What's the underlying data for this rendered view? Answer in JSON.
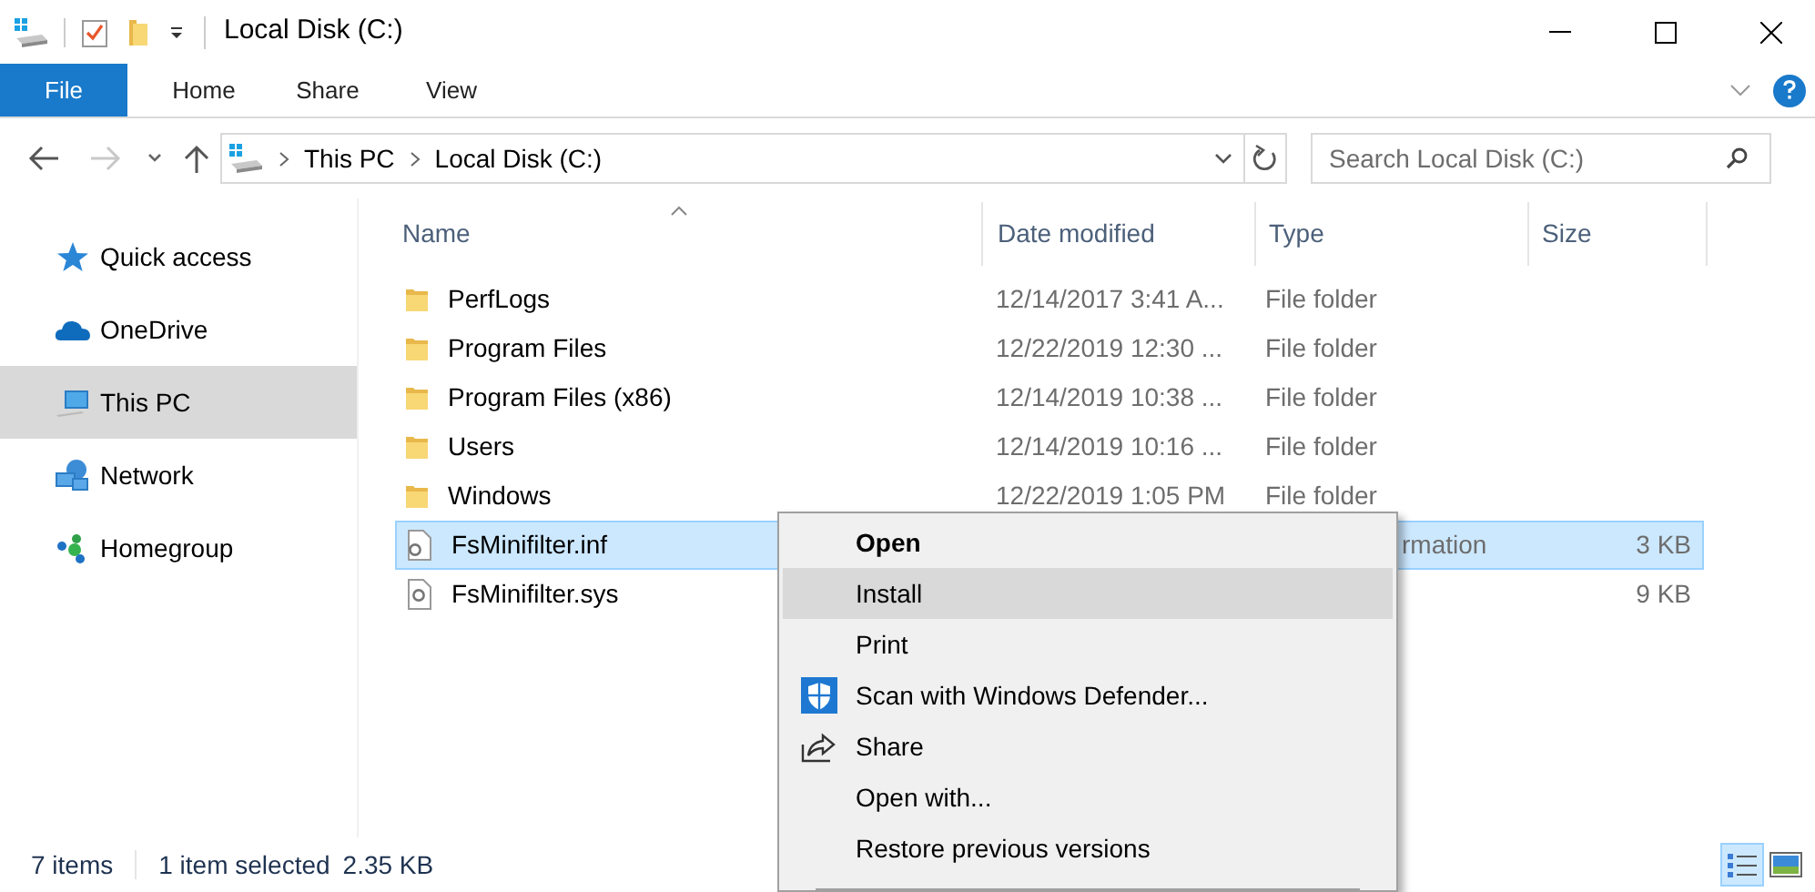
{
  "window": {
    "title": "Local Disk (C:)"
  },
  "ribbon_tabs": [
    {
      "label": "File",
      "kind": "file",
      "selected": false
    },
    {
      "label": "Home",
      "kind": "tab",
      "selected": false
    },
    {
      "label": "Share",
      "kind": "tab",
      "selected": false
    },
    {
      "label": "View",
      "kind": "tab",
      "selected": false
    }
  ],
  "address_bar": {
    "path": [
      "This PC",
      "Local Disk (C:)"
    ]
  },
  "search": {
    "placeholder": "Search Local Disk (C:)"
  },
  "sidebar": {
    "items": [
      {
        "label": "Quick access",
        "kind": "star",
        "selected": false
      },
      {
        "label": "OneDrive",
        "kind": "cloud",
        "selected": false
      },
      {
        "label": "This PC",
        "kind": "pc",
        "selected": true
      },
      {
        "label": "Network",
        "kind": "network",
        "selected": false
      },
      {
        "label": "Homegroup",
        "kind": "homegroup",
        "selected": false
      }
    ]
  },
  "table": {
    "columns": [
      "Name",
      "Date modified",
      "Type",
      "Size"
    ],
    "rows": [
      {
        "kind": "folder",
        "name": "PerfLogs",
        "date": "12/14/2017 3:41 A...",
        "type": "File folder",
        "selected": false
      },
      {
        "kind": "folder",
        "name": "Program Files",
        "date": "12/22/2019 12:30 ...",
        "type": "File folder",
        "selected": false
      },
      {
        "kind": "folder",
        "name": "Program Files (x86)",
        "date": "12/14/2019 10:38 ...",
        "type": "File folder",
        "selected": false
      },
      {
        "kind": "folder",
        "name": "Users",
        "date": "12/14/2019 10:16 ...",
        "type": "File folder",
        "selected": false
      },
      {
        "kind": "folder",
        "name": "Windows",
        "date": "12/22/2019 1:05 PM",
        "type": "File folder",
        "selected": false
      },
      {
        "kind": "inf",
        "name": "FsMinifilter.inf",
        "type_tail": "rmation",
        "size": "3 KB",
        "selected": true
      },
      {
        "kind": "sys",
        "name": "FsMinifilter.sys",
        "size": "9 KB",
        "selected": false
      }
    ]
  },
  "context_menu": {
    "items": [
      {
        "label": "Open",
        "kind": "default",
        "selected": false
      },
      {
        "label": "Install",
        "kind": "plain",
        "selected": true
      },
      {
        "label": "Print",
        "kind": "plain",
        "selected": false
      },
      {
        "label": "Scan with Windows Defender...",
        "kind": "defender",
        "selected": false
      },
      {
        "label": "Share",
        "kind": "share",
        "selected": false
      },
      {
        "label": "Open with...",
        "kind": "plain",
        "selected": false
      },
      {
        "label": "Restore previous versions",
        "kind": "plain",
        "selected": false
      }
    ]
  },
  "status_bar": {
    "item_count": "7 items",
    "selection": "1 item selected",
    "size": "2.35 KB"
  },
  "view_buttons": [
    {
      "kind": "details",
      "selected": true
    },
    {
      "kind": "tiles",
      "selected": false
    }
  ]
}
